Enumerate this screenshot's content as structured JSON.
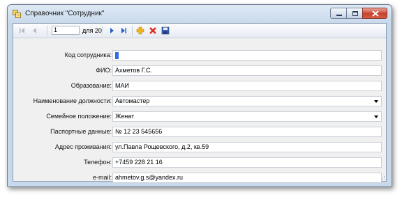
{
  "window": {
    "title": "Справочник \"Сотрудник\"",
    "icons": {
      "app": "app-form-icon",
      "minimize": "minimize-icon",
      "maximize": "maximize-icon",
      "close": "close-icon"
    }
  },
  "toolbar": {
    "position_value": "1",
    "count_label": "для 20",
    "buttons": [
      "move-first-icon",
      "move-previous-icon",
      "move-next-icon",
      "move-last-icon",
      "add-new-icon",
      "delete-icon",
      "save-icon"
    ]
  },
  "fields": [
    {
      "label": "Код сотрудника:",
      "value": ""
    },
    {
      "label": "ФИО:",
      "value": "Ахметов Г.С."
    },
    {
      "label": "Образование:",
      "value": "МАИ"
    },
    {
      "label": "Наименование должности:",
      "value": "Автомастер"
    },
    {
      "label": "Семейное положение:",
      "value": "Женат"
    },
    {
      "label": "Паспортные данные:",
      "value": "№ 12 23 545656"
    },
    {
      "label": "Адрес проживания:",
      "value": "ул.Павла Рощевского, д.2, кв.59"
    },
    {
      "label": "Телефон:",
      "value": "+7459 228 21 16"
    },
    {
      "label": "e-mail:",
      "value": "ahmetov.g.s@yandex.ru"
    }
  ]
}
